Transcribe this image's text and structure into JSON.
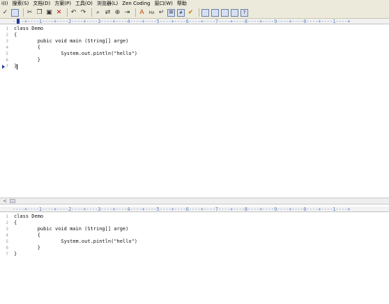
{
  "menu": {
    "items": [
      "i(I)",
      "搜索(S)",
      "文档(D)",
      "方案(P)",
      "工具(O)",
      "浏览器(L)",
      "Zen Coding",
      "窗口(W)",
      "帮助"
    ]
  },
  "toolbar": {
    "icons": [
      "save-icon",
      "save-all-icon",
      "cut-icon",
      "copy-icon",
      "paste-icon",
      "delete-icon",
      "undo-icon",
      "redo-icon",
      "find-icon",
      "replace-icon",
      "find-in-files-icon",
      "indent-icon",
      "font-size-icon",
      "hex-icon",
      "wrap-icon",
      "list-icon",
      "line-numbers-icon",
      "spell-check-icon",
      "window-icon",
      "window-tile-icon",
      "window-cascade-icon",
      "window-list-icon",
      "help-icon"
    ]
  },
  "ruler": {
    "text": "----+----1----+----2----+----3----+----4----+----5----+----6----+----7----+----8----+----9----+----0----+----1----+"
  },
  "editor_top": {
    "lines": [
      {
        "num": "1",
        "text": "class Demo"
      },
      {
        "num": "2",
        "text": "{"
      },
      {
        "num": "3",
        "text": "        pubic void main (String[] arge)"
      },
      {
        "num": "4",
        "text": "        {"
      },
      {
        "num": "5",
        "text": "                System.out.pintln(\"hello\")"
      },
      {
        "num": "6",
        "text": "        }"
      },
      {
        "num": "7",
        "text": "}"
      }
    ]
  },
  "editor_bottom": {
    "lines": [
      {
        "num": "1",
        "text": "class Demo"
      },
      {
        "num": "2",
        "text": "{"
      },
      {
        "num": "3",
        "text": "        pubic void main (String[] arge)"
      },
      {
        "num": "4",
        "text": "        {"
      },
      {
        "num": "5",
        "text": "                System.out.pintln(\"hello\")"
      },
      {
        "num": "6",
        "text": "        }"
      },
      {
        "num": "7",
        "text": "}"
      }
    ]
  },
  "scroll_arrow": "<"
}
